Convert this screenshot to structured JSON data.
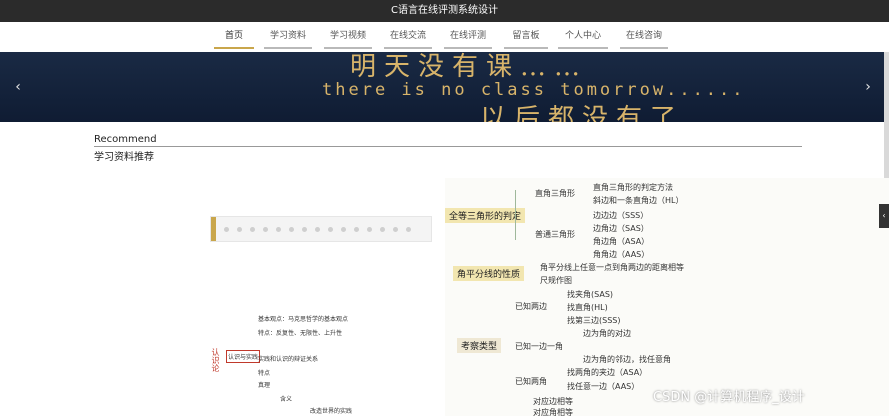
{
  "header": {
    "title": "C语言在线评测系统设计"
  },
  "nav": {
    "items": [
      {
        "label": "首页",
        "active": true
      },
      {
        "label": "学习资料",
        "active": false
      },
      {
        "label": "学习视频",
        "active": false
      },
      {
        "label": "在线交流",
        "active": false
      },
      {
        "label": "在线评测",
        "active": false
      },
      {
        "label": "留言板",
        "active": false
      },
      {
        "label": "个人中心",
        "active": false
      },
      {
        "label": "在线咨询",
        "active": false
      }
    ]
  },
  "banner": {
    "line1": "明天没有课……",
    "line2": "there is no class tomorrow......",
    "line3": "以后都没有了……",
    "prev_icon": "chevron-left-icon",
    "next_icon": "chevron-right-icon"
  },
  "section": {
    "title": "Recommend",
    "subtitle": "学习资料推荐"
  },
  "mindmap_right": {
    "main1": "全等三角形的判定",
    "branch1": "直角三角形",
    "b1_items": [
      "直角三角形的判定方法",
      "斜边和一条直角边（HL）"
    ],
    "branch2": "普通三角形",
    "b2_items": [
      "边边边（SSS）",
      "边角边（SAS）",
      "角边角（ASA）",
      "角角边（AAS）"
    ],
    "main2": "角平分线的性质",
    "m2_items": [
      "角平分线上任意一点到角两边的距离相等",
      "尺规作图"
    ],
    "main3": "考察类型",
    "known1": "已知两边",
    "k1_items": [
      "找夹角(SAS)",
      "找直角(HL)",
      "找第三边(SSS)"
    ],
    "known2": "已知一边一角",
    "k2_items": [
      "边为角的对边",
      "边为角的邻边，找任意角"
    ],
    "known3": "已知两角",
    "k3_items": [
      "找两角的夹边（ASA）",
      "找任意一边（AAS）"
    ],
    "tail_items": [
      "对应边相等",
      "对应角相等"
    ]
  },
  "mindmap_left": {
    "red_label": "认识论",
    "node1": "认识与实践",
    "items": [
      "基本观点：马克思哲学的基本观点",
      "特点：反复性、无限性、上升性",
      "实践和认识的辩证关系",
      "特点",
      "真理",
      "含义",
      "改造世界的实践"
    ]
  },
  "side_tab": {
    "label": "‹"
  },
  "watermark": "CSDN @计算机程序_设计"
}
